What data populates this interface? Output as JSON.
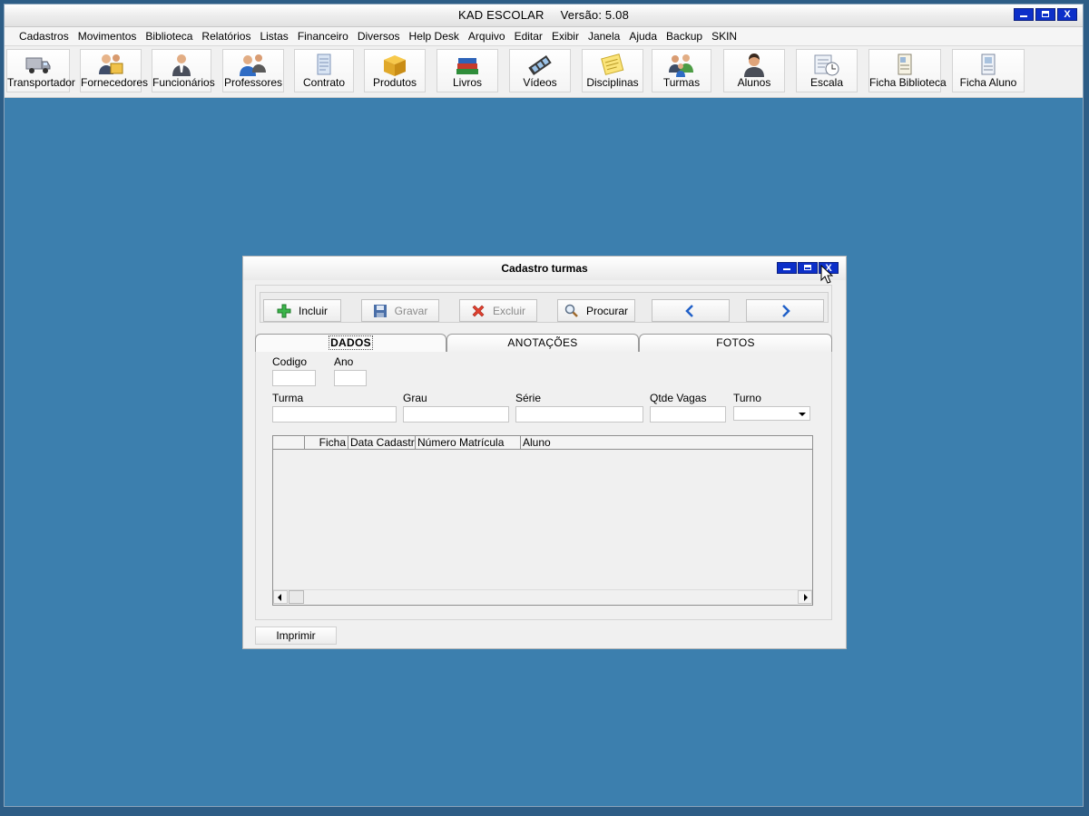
{
  "window": {
    "title": "KAD ESCOLAR",
    "version": "Versão: 5.08",
    "minimize_label": "",
    "maximize_label": "",
    "close_label": "X"
  },
  "menu": [
    "Cadastros",
    "Movimentos",
    "Biblioteca",
    "Relatórios",
    "Listas",
    "Financeiro",
    "Diversos",
    "Help Desk",
    "Arquivo",
    "Editar",
    "Exibir",
    "Janela",
    "Ajuda",
    "Backup",
    "SKIN"
  ],
  "toolbar": [
    {
      "label": "Transportador",
      "icon": "truck-icon"
    },
    {
      "label": "Fornecedores",
      "icon": "suppliers-icon"
    },
    {
      "label": "Funcionários",
      "icon": "employee-icon"
    },
    {
      "label": "Professores",
      "icon": "teachers-icon"
    },
    {
      "label": "Contrato",
      "icon": "contract-icon"
    },
    {
      "label": "Produtos",
      "icon": "box-icon"
    },
    {
      "label": "Livros",
      "icon": "books-icon"
    },
    {
      "label": "Vídeos",
      "icon": "film-icon"
    },
    {
      "label": "Disciplinas",
      "icon": "notes-icon"
    },
    {
      "label": "Turmas",
      "icon": "group-icon"
    },
    {
      "label": "Alunos",
      "icon": "student-icon"
    },
    {
      "label": "Escala",
      "icon": "schedule-icon"
    },
    {
      "label": "Ficha Biblioteca",
      "icon": "library-card-icon"
    },
    {
      "label": "Ficha Aluno",
      "icon": "student-card-icon"
    }
  ],
  "dialog": {
    "title": "Cadastro turmas",
    "actions": {
      "incluir": "Incluir",
      "gravar": "Gravar",
      "excluir": "Excluir",
      "procurar": "Procurar"
    },
    "tabs": [
      "DADOS",
      "ANOTAÇÕES",
      "FOTOS"
    ],
    "fields": {
      "codigo": {
        "label": "Codigo",
        "value": ""
      },
      "ano": {
        "label": "Ano",
        "value": ""
      },
      "turma": {
        "label": "Turma",
        "value": ""
      },
      "grau": {
        "label": "Grau",
        "value": ""
      },
      "serie": {
        "label": "Série",
        "value": ""
      },
      "qtde_vagas": {
        "label": "Qtde Vagas",
        "value": ""
      },
      "turno": {
        "label": "Turno",
        "value": ""
      }
    },
    "grid": {
      "columns": [
        "",
        "Ficha",
        "Data Cadastro",
        "Número Matrícula",
        "Aluno"
      ],
      "rows": []
    },
    "print_label": "Imprimir"
  },
  "colors": {
    "desktop": "#3c7fae",
    "window_button": "#0c2fc9"
  }
}
